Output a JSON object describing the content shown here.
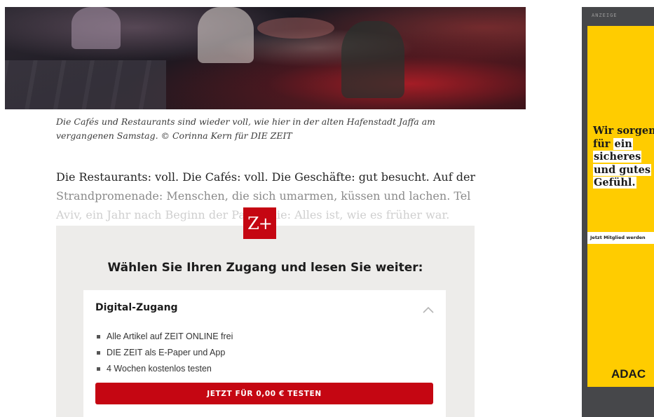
{
  "article": {
    "caption_line1": "Die Cafés und Restaurants sind wieder voll, wie hier in der alten Hafenstadt Jaffa am",
    "caption_line2": "vergangenen Samstag. © Corinna Kern für DIE ZEIT",
    "body_line1": "Die Restaurants: voll. Die Cafés: voll. Die Geschäfte: gut besucht. Auf der",
    "body_line2": "Strandpromenade: Menschen, die sich umarmen, küssen und lachen. Tel",
    "body_line3": "Aviv, ein Jahr nach Beginn der Pandemie: Alles ist, wie es früher war."
  },
  "paywall": {
    "badge": "Z+",
    "title": "Wählen Sie Ihren Zugang und lesen Sie weiter:",
    "offer": {
      "title": "Digital-Zugang",
      "features": [
        "Alle Artikel auf ZEIT ONLINE frei",
        "DIE ZEIT als E-Paper und App",
        "4 Wochen kostenlos testen"
      ],
      "cta_label": "JETZT FÜR 0,00 € TESTEN"
    }
  },
  "ad": {
    "label": "ANZEIGE",
    "headline_line1": "Wir sorgen",
    "headline_line2a": "für",
    "headline_line2b": "ein",
    "headline_line3": "sicheres",
    "headline_line4": "und gutes",
    "headline_line5": "Gefühl.",
    "button_label": "Jetzt Mitglied werden",
    "logo": "ADAC",
    "colors": {
      "background": "#ffcc00",
      "frame": "#46474a"
    }
  },
  "colors": {
    "accent": "#c50612",
    "paywall_bg": "#edecea"
  }
}
